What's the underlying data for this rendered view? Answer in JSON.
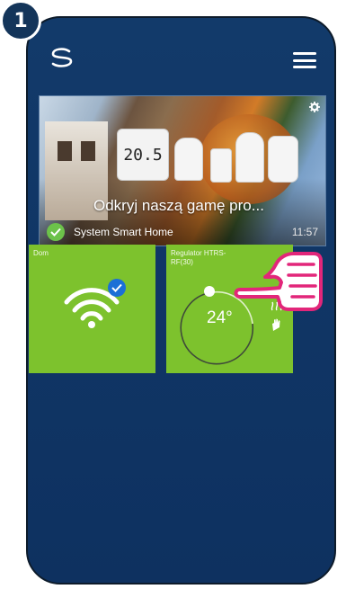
{
  "step": {
    "number": "1"
  },
  "app": {
    "logo_icon": "syncro-logo-icon",
    "menu_icon": "hamburger-menu-icon"
  },
  "banner": {
    "title": "Odkryj naszą gamę pro...",
    "status_label": "System Smart Home",
    "time": "11:57",
    "thermostat_display": "20.5",
    "settings_icon": "gear-icon",
    "status_icon": "check-circle-icon"
  },
  "tiles": [
    {
      "name": "Dom",
      "icon": "wifi-connected-icon",
      "badge_icon": "check-badge-icon"
    },
    {
      "name": "Regulator HTRS-RF(30)",
      "temperature": "24°",
      "icons": [
        "heating-icon",
        "hand-manual-icon"
      ]
    }
  ],
  "colors": {
    "screen_bg": "#0e3160",
    "tile_green": "#7dc22d",
    "step_badge": "#14355a",
    "check_green": "#6cc24a",
    "hand_outline": "#e2267a"
  }
}
